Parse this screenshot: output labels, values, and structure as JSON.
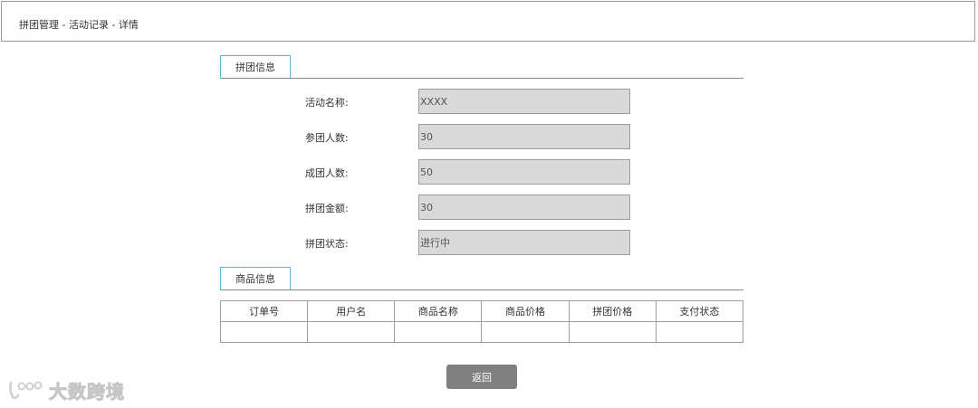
{
  "header": {
    "breadcrumb": "拼团管理 - 活动记录 - 详情"
  },
  "group_section": {
    "title": "拼团信息",
    "fields": [
      {
        "label": "活动名称:",
        "value": "XXXX"
      },
      {
        "label": "参团人数:",
        "value": "30"
      },
      {
        "label": "成团人数:",
        "value": "50"
      },
      {
        "label": "拼团金额:",
        "value": "30"
      },
      {
        "label": "拼团状态:",
        "value": "进行中"
      }
    ]
  },
  "product_section": {
    "title": "商品信息",
    "columns": [
      "订单号",
      "用户名",
      "商品名称",
      "商品价格",
      "拼团价格",
      "支付状态"
    ]
  },
  "footer": {
    "back_label": "返回"
  },
  "watermark": {
    "text": "大数跨境"
  }
}
